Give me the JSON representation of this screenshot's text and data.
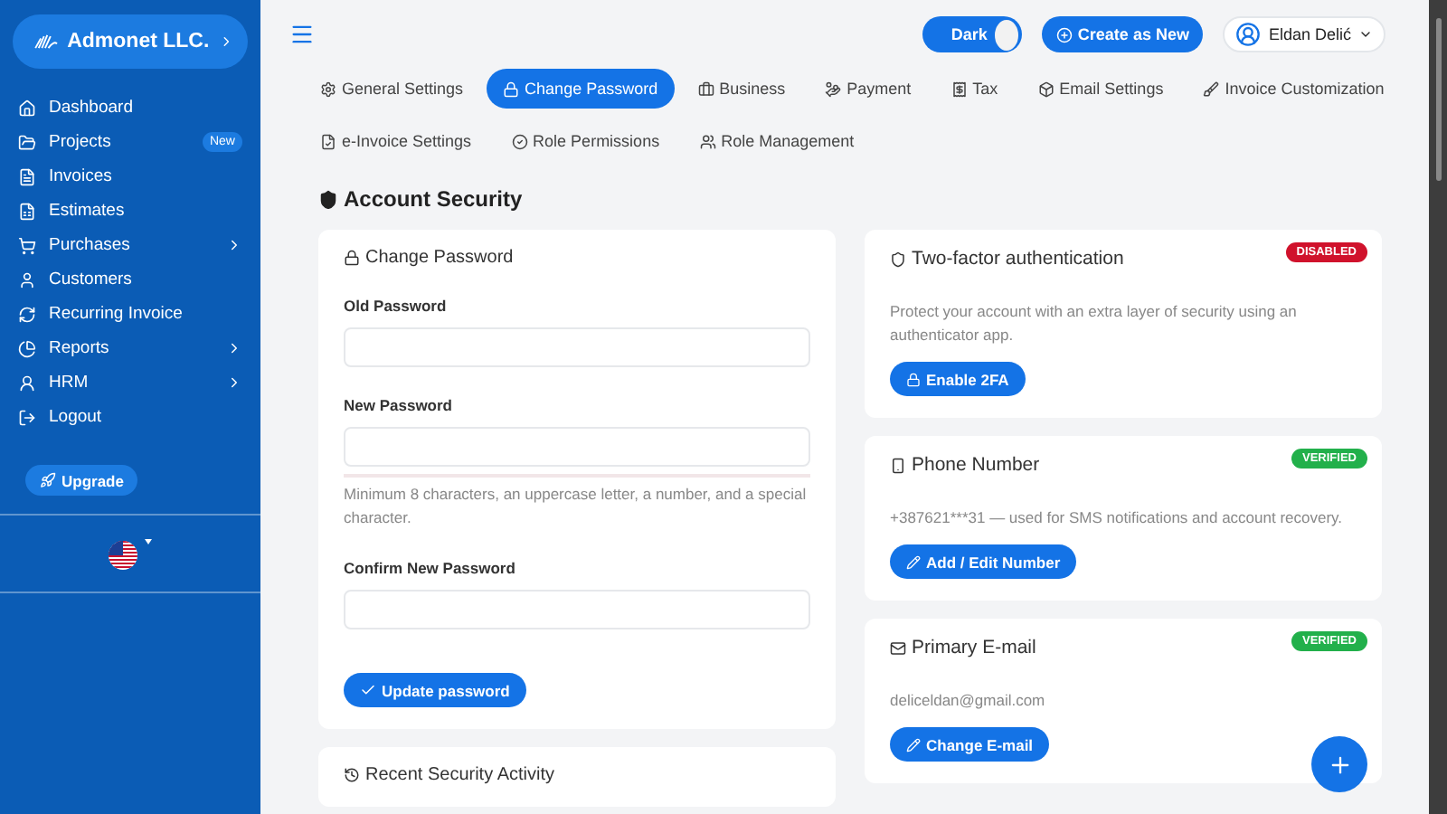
{
  "sidebar": {
    "company": "Admonet LLC.",
    "items": [
      {
        "label": "Dashboard",
        "selected": false,
        "submenu": false
      },
      {
        "label": "Projects",
        "selected": false,
        "submenu": false,
        "badge": "New"
      },
      {
        "label": "Invoices",
        "selected": false,
        "submenu": false
      },
      {
        "label": "Estimates",
        "selected": false,
        "submenu": false
      },
      {
        "label": "Purchases",
        "selected": false,
        "submenu": true
      },
      {
        "label": "Customers",
        "selected": false,
        "submenu": false
      },
      {
        "label": "Recurring Invoice",
        "selected": false,
        "submenu": false
      },
      {
        "label": "Reports",
        "selected": false,
        "submenu": true
      },
      {
        "label": "HRM",
        "selected": false,
        "submenu": true
      },
      {
        "label": "Logout",
        "selected": false,
        "submenu": false
      }
    ],
    "upgrade": "Upgrade"
  },
  "topbar": {
    "theme_toggle": {
      "label": "Dark",
      "on": true
    },
    "create_button": "Create as New",
    "user": "Eldan Delić"
  },
  "tabs": [
    {
      "label": "General Settings",
      "selected": false
    },
    {
      "label": "Change Password",
      "selected": true
    },
    {
      "label": "Business",
      "selected": false
    },
    {
      "label": "Payment",
      "selected": false
    },
    {
      "label": "Tax",
      "selected": false
    },
    {
      "label": "Email Settings",
      "selected": false
    },
    {
      "label": "Invoice Customization",
      "selected": false
    },
    {
      "label": "e-Invoice Settings",
      "selected": false
    },
    {
      "label": "Role Permissions",
      "selected": false
    },
    {
      "label": "Role Management",
      "selected": false
    }
  ],
  "heading": "Account Security",
  "password_card": {
    "title": "Change Password",
    "fields": [
      {
        "label": "Old Password"
      },
      {
        "label": "New Password",
        "meter": {
          "level": 0
        },
        "hint": "Minimum 8 characters, an uppercase letter, a number, and a special character."
      },
      {
        "label": "Confirm New Password"
      }
    ],
    "button": "Update password"
  },
  "activity_card": {
    "title": "Recent Security Activity"
  },
  "cards": [
    {
      "title": "Two-factor authentication",
      "badge": "DISABLED",
      "color": "#d0122c",
      "text": "Protect your account with an extra layer of security using an authenticator app.",
      "button": "Enable 2FA"
    },
    {
      "title": "Phone Number",
      "badge": "VERIFIED",
      "color": "#22b04b",
      "text": "+387621***31 — used for SMS notifications and account recovery.",
      "button": "Add / Edit Number"
    },
    {
      "title": "Primary E-mail",
      "badge": "VERIFIED",
      "color": "#22b04b",
      "text": "deliceldan@gmail.com",
      "button": "Change E-mail"
    }
  ]
}
